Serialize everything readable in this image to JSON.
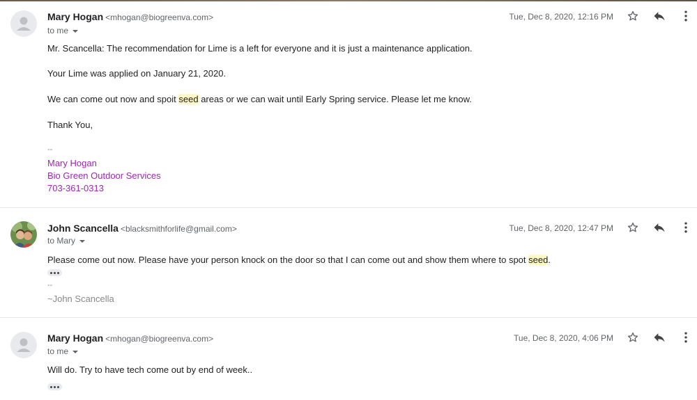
{
  "messages": [
    {
      "sender_name": "Mary Hogan",
      "sender_email": "<mhogan@biogreenva.com>",
      "recipient": "to me",
      "date": "Tue, Dec 8, 2020, 12:16 PM",
      "body": {
        "line1": "Mr. Scancella: The recommendation for Lime is a left for everyone and it is just a maintenance application.",
        "line2": "Your Lime was applied on January 21, 2020.",
        "line3_before": "We can come out now and spoit ",
        "line3_highlight": "seed",
        "line3_after": " areas or we can wait until Early Spring service.  Please let me know.",
        "line4": "Thank You,"
      },
      "signature": {
        "dashes": "--",
        "name": "Mary Hogan",
        "company": "Bio Green Outdoor Services",
        "phone": "703-361-0313"
      }
    },
    {
      "sender_name": "John Scancella",
      "sender_email": "<blacksmithforlife@gmail.com>",
      "recipient": "to Mary",
      "date": "Tue, Dec 8, 2020, 12:47 PM",
      "body": {
        "line1_before": "Please come out now. Please have your person knock on the door so that I can come out and show them where to spot ",
        "line1_highlight": "seed",
        "line1_after": "."
      },
      "signature": {
        "dashes": "--",
        "name": "~John Scancella"
      }
    },
    {
      "sender_name": "Mary Hogan",
      "sender_email": "<mhogan@biogreenva.com>",
      "recipient": "to me",
      "date": "Tue, Dec 8, 2020, 4:06 PM",
      "body": {
        "line1": "Will do. Try to have tech come out by end of week.."
      }
    }
  ],
  "icons": {
    "star": "star-icon",
    "reply": "reply-icon",
    "more": "more-vert-icon",
    "avatar_default": "person-icon",
    "caret": "chevron-down-icon"
  },
  "colors": {
    "signature": "#9c27b0",
    "highlight": "#fff9c4",
    "muted": "#888888"
  }
}
